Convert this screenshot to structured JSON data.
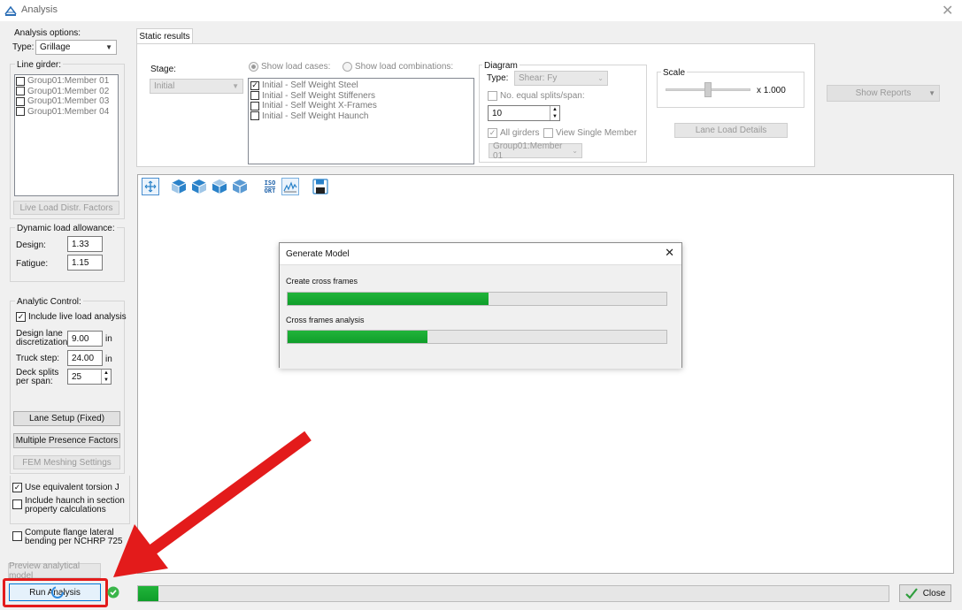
{
  "window": {
    "title": "Analysis"
  },
  "left": {
    "analysis_options_label": "Analysis options:",
    "type_label": "Type:",
    "type_value": "Grillage",
    "line_girder_label": "Line girder:",
    "members": [
      "Group01:Member 01",
      "Group01:Member 02",
      "Group01:Member 03",
      "Group01:Member 04"
    ],
    "live_load_button": "Live Load Distr. Factors",
    "dynamic_label": "Dynamic load allowance:",
    "design_label": "Design:",
    "design_value": "1.33",
    "fatigue_label": "Fatigue:",
    "fatigue_value": "1.15",
    "analytic_label": "Analytic Control:",
    "include_live_load": "Include live load analysis",
    "design_lane_label_1": "Design lane",
    "design_lane_label_2": "discretization:",
    "design_lane_value": "9.00",
    "unit_in": "in",
    "truck_step_label": "Truck step:",
    "truck_step_value": "24.00",
    "deck_splits_label_1": "Deck splits",
    "deck_splits_label_2": "per span:",
    "deck_splits_value": "25",
    "lane_setup_button": "Lane Setup (Fixed)",
    "multiple_presence_button": "Multiple Presence Factors",
    "fem_meshing_button": "FEM Meshing Settings",
    "use_torsion": "Use equivalent torsion J",
    "include_haunch_1": "Include haunch in section",
    "include_haunch_2": "property calculations",
    "compute_flange_1": "Compute flange lateral",
    "compute_flange_2": "bending per NCHRP 725",
    "preview_button": "Preview analytical model",
    "run_button": "Run Analysis"
  },
  "tab": {
    "label": "Static results"
  },
  "static": {
    "stage_label": "Stage:",
    "stage_value": "Initial",
    "show_load_cases": "Show load cases:",
    "show_load_combinations": "Show load combinations:",
    "load_cases": [
      "Initial - Self Weight Steel",
      "Initial - Self Weight Stiffeners",
      "Initial - Self Weight X-Frames",
      "Initial - Self Weight Haunch"
    ],
    "diagram_label": "Diagram",
    "diagram_type_label": "Type:",
    "diagram_type_value": "Shear: Fy",
    "equal_splits_label": "No. equal splits/span:",
    "equal_splits_value": "10",
    "all_girders": "All girders",
    "view_single_member": "View Single Member",
    "member_value": "Group01:Member 01",
    "scale_label": "Scale",
    "scale_value": "x 1.000",
    "lane_load_details": "Lane Load Details",
    "show_reports": "Show Reports"
  },
  "toolbar": {
    "icons": [
      "pan-icon",
      "view-cube-front-icon",
      "view-cube-side-icon",
      "view-cube-top-icon",
      "view-cube-iso-icon",
      "iso-ort-icon",
      "chart-icon",
      "save-icon"
    ],
    "iso_top": "ISO",
    "iso_bottom": "ORT"
  },
  "dialog": {
    "title": "Generate Model",
    "task1_label": "Create cross frames",
    "task1_progress": 0.53,
    "task2_label": "Cross frames analysis",
    "task2_progress": 0.37
  },
  "status": {
    "progress": 0.027
  },
  "close_button": "Close",
  "colors": {
    "progress_green": "#16a630",
    "highlight_red": "#e31b1b",
    "icon_blue": "#2a82c9"
  }
}
